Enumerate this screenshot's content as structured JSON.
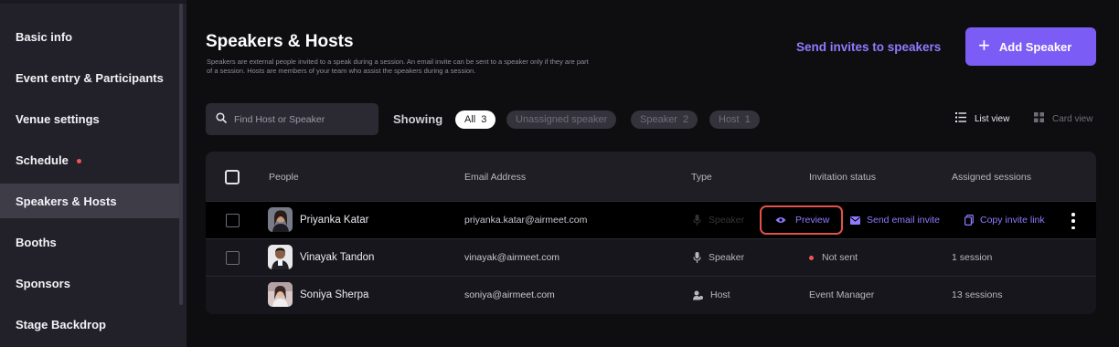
{
  "sidebar": {
    "items": [
      {
        "label": "Basic info"
      },
      {
        "label": "Event entry & Participants"
      },
      {
        "label": "Venue settings"
      },
      {
        "label": "Schedule"
      },
      {
        "label": "Speakers & Hosts"
      },
      {
        "label": "Booths"
      },
      {
        "label": "Sponsors"
      },
      {
        "label": "Stage Backdrop"
      }
    ]
  },
  "header": {
    "title": "Speakers & Hosts",
    "description": "Speakers are external people invited to a speak during a session. An email invite can be sent to a speaker only if they are part of a session. Hosts are members of your team who assist the speakers during a session.",
    "send_invites_label": "Send invites to speakers",
    "add_speaker_label": "Add Speaker"
  },
  "filters": {
    "search_placeholder": "Find Host or Speaker",
    "showing_label": "Showing",
    "chips": [
      {
        "label": "All",
        "count": "3"
      },
      {
        "label": "Unassigned speaker",
        "count": ""
      },
      {
        "label": "Speaker",
        "count": "2"
      },
      {
        "label": "Host",
        "count": "1"
      }
    ],
    "list_view_label": "List view",
    "card_view_label": "Card view"
  },
  "table": {
    "columns": [
      "People",
      "Email Address",
      "Type",
      "Invitation status",
      "Assigned sessions"
    ],
    "rows": [
      {
        "name": "Priyanka Katar",
        "email": "priyanka.katar@airmeet.com",
        "type": "Speaker",
        "status": "",
        "sessions": ""
      },
      {
        "name": "Vinayak Tandon",
        "email": "vinayak@airmeet.com",
        "type": "Speaker",
        "status": "Not sent",
        "sessions": "1 session"
      },
      {
        "name": "Soniya Sherpa",
        "email": "soniya@airmeet.com",
        "type": "Host",
        "status": "Event Manager",
        "sessions": "13 sessions"
      }
    ],
    "row_actions": {
      "preview_label": "Preview",
      "send_email_label": "Send email invite",
      "copy_link_label": "Copy invite link"
    }
  },
  "colors": {
    "accent": "#7b5cf5",
    "link": "#8f7bff",
    "highlight_outline": "#e0524a",
    "status_dot": "#f05454"
  }
}
